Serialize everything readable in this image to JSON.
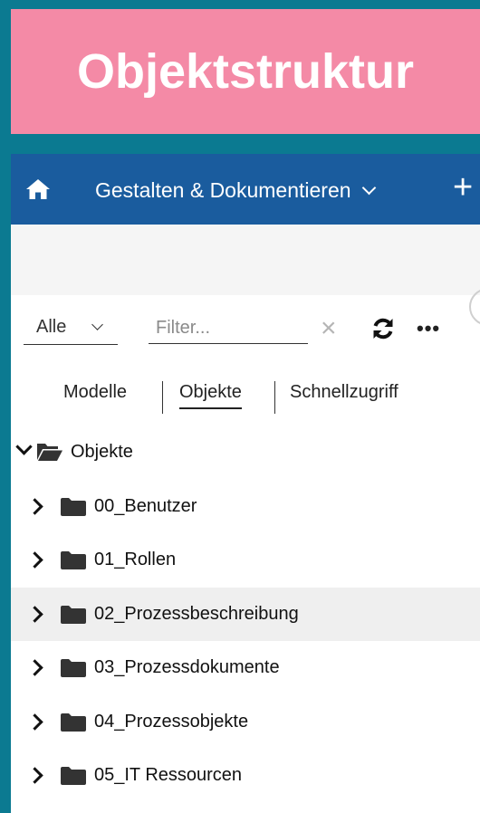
{
  "banner": {
    "title": "Objektstruktur"
  },
  "topbar": {
    "menu_label": "Gestalten & Dokumentieren",
    "home_icon": "home-icon",
    "add_icon": "plus-icon"
  },
  "toolbar": {
    "scope_value": "Alle",
    "filter_placeholder": "Filter...",
    "clear_icon": "close-icon",
    "refresh_icon": "refresh-icon",
    "more_icon": "more-icon"
  },
  "tabs": [
    {
      "label": "Modelle",
      "active": false
    },
    {
      "label": "Objekte",
      "active": true
    },
    {
      "label": "Schnellzugriff",
      "active": false
    }
  ],
  "tree": {
    "root": {
      "label": "Objekte",
      "expanded": true
    },
    "children": [
      {
        "label": "00_Benutzer",
        "highlighted": false
      },
      {
        "label": "01_Rollen",
        "highlighted": false
      },
      {
        "label": "02_Prozessbeschreibung",
        "highlighted": true
      },
      {
        "label": "03_Prozessdokumente",
        "highlighted": false
      },
      {
        "label": "04_Prozessobjekte",
        "highlighted": false
      },
      {
        "label": "05_IT Ressourcen",
        "highlighted": false
      }
    ]
  },
  "colors": {
    "background": "#0b7a91",
    "banner": "#f48aa6",
    "topbar": "#1a5c9e",
    "highlight_row": "#efefef"
  }
}
